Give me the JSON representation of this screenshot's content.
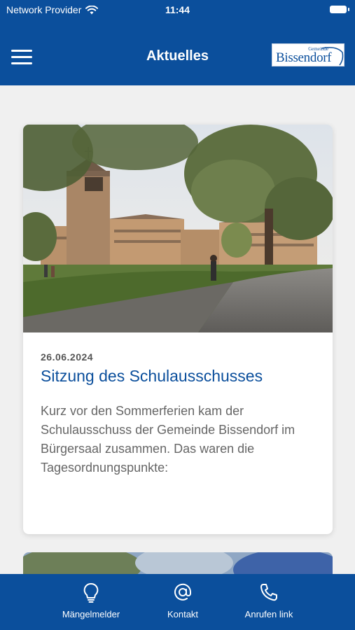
{
  "status_bar": {
    "provider": "Network Provider",
    "time": "11:44"
  },
  "header": {
    "title": "Aktuelles",
    "logo_top": "Gemeinde",
    "logo_name": "Bissendorf"
  },
  "news": [
    {
      "date": "26.06.2024",
      "title": "Sitzung des Schulausschusses",
      "excerpt": "Kurz vor den Sommerferien kam der Schulausschuss der Gemeinde Bissendorf im Bürgersaal zusammen. Das waren die Tagesordnungspunkte:"
    }
  ],
  "tabbar": {
    "tabs": [
      {
        "label": "Mängelmelder",
        "icon": "lightbulb-icon"
      },
      {
        "label": "Kontakt",
        "icon": "at-icon"
      },
      {
        "label": "Anrufen link",
        "icon": "phone-icon"
      }
    ]
  },
  "colors": {
    "brand": "#0b4f9c",
    "background": "#f0f0f0"
  }
}
